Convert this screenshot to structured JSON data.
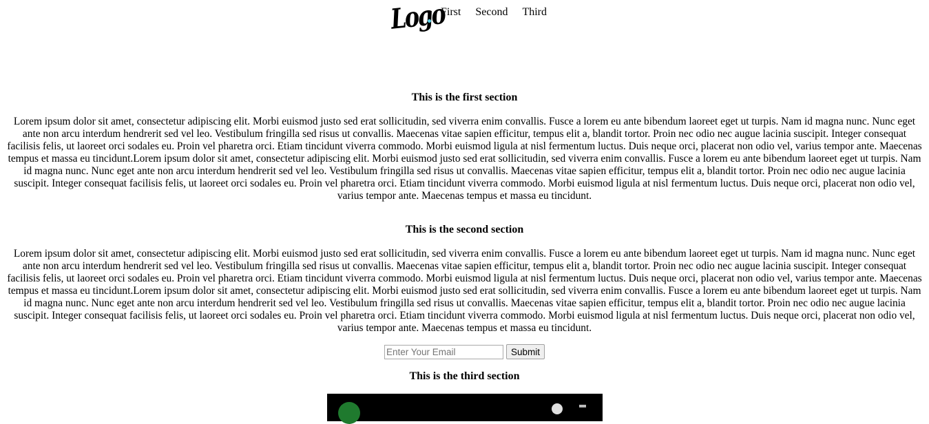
{
  "header": {
    "logo_text": "Logo",
    "nav": [
      "First",
      "Second",
      "Third"
    ]
  },
  "sections": [
    {
      "title": "This is the first section",
      "body": "Lorem ipsum dolor sit amet, consectetur adipiscing elit. Morbi euismod justo sed erat sollicitudin, sed viverra enim convallis. Fusce a lorem eu ante bibendum laoreet eget ut turpis. Nam id magna nunc. Nunc eget ante non arcu interdum hendrerit sed vel leo. Vestibulum fringilla sed risus ut convallis. Maecenas vitae sapien efficitur, tempus elit a, blandit tortor. Proin nec odio nec augue lacinia suscipit. Integer consequat facilisis felis, ut laoreet orci sodales eu. Proin vel pharetra orci. Etiam tincidunt viverra commodo. Morbi euismod ligula at nisl fermentum luctus. Duis neque orci, placerat non odio vel, varius tempor ante. Maecenas tempus et massa eu tincidunt.Lorem ipsum dolor sit amet, consectetur adipiscing elit. Morbi euismod justo sed erat sollicitudin, sed viverra enim convallis. Fusce a lorem eu ante bibendum laoreet eget ut turpis. Nam id magna nunc. Nunc eget ante non arcu interdum hendrerit sed vel leo. Vestibulum fringilla sed risus ut convallis. Maecenas vitae sapien efficitur, tempus elit a, blandit tortor. Proin nec odio nec augue lacinia suscipit. Integer consequat facilisis felis, ut laoreet orci sodales eu. Proin vel pharetra orci. Etiam tincidunt viverra commodo. Morbi euismod ligula at nisl fermentum luctus. Duis neque orci, placerat non odio vel, varius tempor ante. Maecenas tempus et massa eu tincidunt."
    },
    {
      "title": "This is the second section",
      "body": "Lorem ipsum dolor sit amet, consectetur adipiscing elit. Morbi euismod justo sed erat sollicitudin, sed viverra enim convallis. Fusce a lorem eu ante bibendum laoreet eget ut turpis. Nam id magna nunc. Nunc eget ante non arcu interdum hendrerit sed vel leo. Vestibulum fringilla sed risus ut convallis. Maecenas vitae sapien efficitur, tempus elit a, blandit tortor. Proin nec odio nec augue lacinia suscipit. Integer consequat facilisis felis, ut laoreet orci sodales eu. Proin vel pharetra orci. Etiam tincidunt viverra commodo. Morbi euismod ligula at nisl fermentum luctus. Duis neque orci, placerat non odio vel, varius tempor ante. Maecenas tempus et massa eu tincidunt.Lorem ipsum dolor sit amet, consectetur adipiscing elit. Morbi euismod justo sed erat sollicitudin, sed viverra enim convallis. Fusce a lorem eu ante bibendum laoreet eget ut turpis. Nam id magna nunc. Nunc eget ante non arcu interdum hendrerit sed vel leo. Vestibulum fringilla sed risus ut convallis. Maecenas vitae sapien efficitur, tempus elit a, blandit tortor. Proin nec odio nec augue lacinia suscipit. Integer consequat facilisis felis, ut laoreet orci sodales eu. Proin vel pharetra orci. Etiam tincidunt viverra commodo. Morbi euismod ligula at nisl fermentum luctus. Duis neque orci, placerat non odio vel, varius tempor ante. Maecenas tempus et massa eu tincidunt."
    },
    {
      "title": "This is the third section"
    }
  ],
  "form": {
    "email_placeholder": "Enter Your Email",
    "submit_label": "Submit"
  },
  "colors": {
    "logo_dot": "#5ad1e8",
    "video_background": "#000000"
  },
  "icons": {
    "logo": "logo-wordmark",
    "video_channel": "channel-avatar-icon",
    "video_control": "video-control-icon"
  }
}
